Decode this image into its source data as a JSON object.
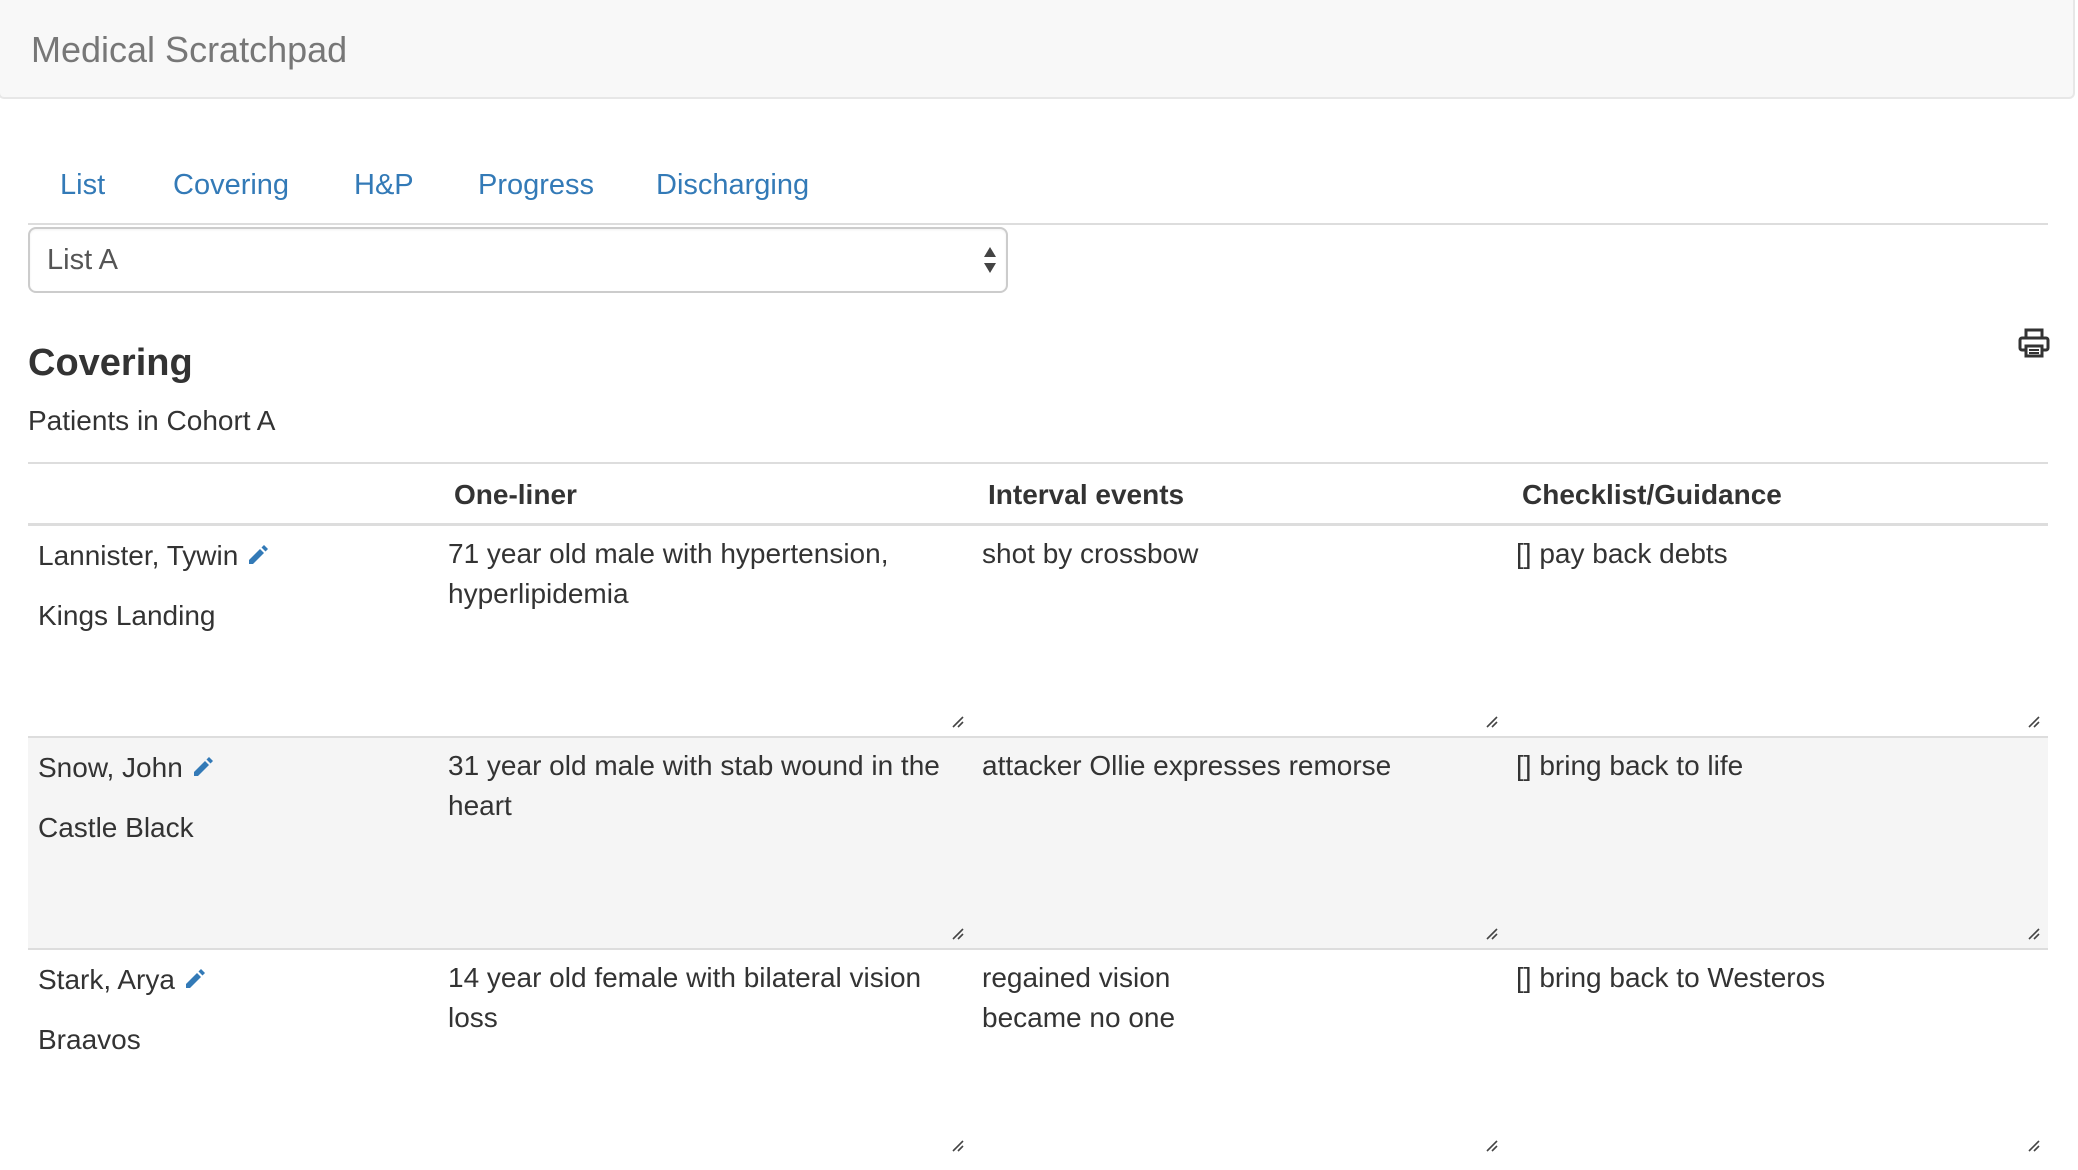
{
  "app": {
    "title": "Medical Scratchpad"
  },
  "tabs": [
    {
      "label": "List"
    },
    {
      "label": "Covering"
    },
    {
      "label": "H&P"
    },
    {
      "label": "Progress"
    },
    {
      "label": "Discharging"
    }
  ],
  "list_select": {
    "selected": "List A"
  },
  "section": {
    "title": "Covering",
    "subtitle": "Patients in Cohort A"
  },
  "table": {
    "headers": [
      "",
      "One-liner",
      "Interval events",
      "Checklist/Guidance"
    ],
    "rows": [
      {
        "name": "Lannister, Tywin",
        "location": "Kings Landing",
        "one_liner": "71 year old male with hypertension, hyperlipidemia",
        "interval_events": "shot by crossbow",
        "checklist": "[] pay back debts"
      },
      {
        "name": "Snow, John",
        "location": "Castle Black",
        "one_liner": "31 year old male with stab wound in the heart",
        "interval_events": "attacker Ollie expresses remorse",
        "checklist": "[] bring back to life"
      },
      {
        "name": "Stark, Arya",
        "location": "Braavos",
        "one_liner": "14 year old female with bilateral vision loss",
        "interval_events": "regained vision\nbecame no one",
        "checklist": "[] bring back to Westeros"
      }
    ]
  },
  "icons": {
    "edit": "pencil-icon",
    "print": "print-icon",
    "select_arrows": "sort-arrows-icon",
    "resize": "resize-grip-icon"
  },
  "colors": {
    "link": "#337ab7",
    "navbar_bg": "#f8f8f8",
    "brand_text": "#777777",
    "stripe": "#f5f5f5",
    "border": "#dddddd"
  }
}
